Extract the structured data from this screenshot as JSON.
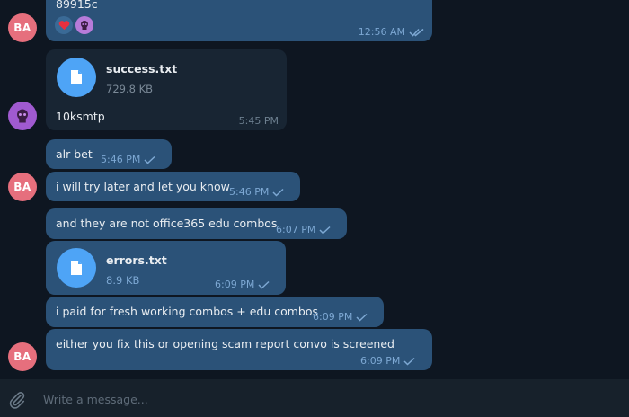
{
  "colors": {
    "background": "#0e1621",
    "outgoing_bubble": "#2b5278",
    "incoming_bubble": "#182533",
    "accent": "#4ea4f6",
    "avatar_ba": "#e66f7d",
    "avatar_other": "#a05ad0"
  },
  "messages": [
    {
      "id": "m0",
      "text": "89915c",
      "time": "12:56 AM",
      "reactions": [
        "heart",
        "skull"
      ],
      "status": "read"
    },
    {
      "id": "m1",
      "file_name": "success.txt",
      "file_size": "729.8 KB",
      "text": "10ksmtp",
      "time": "5:45 PM"
    },
    {
      "id": "m2",
      "text": "alr bet",
      "time": "5:46 PM",
      "status": "sent"
    },
    {
      "id": "m3",
      "text": "i will try later and let you know",
      "time": "5:46 PM",
      "status": "sent"
    },
    {
      "id": "m4",
      "text": "and they are not office365 edu combos",
      "time": "6:07 PM",
      "status": "sent"
    },
    {
      "id": "m5",
      "file_name": "errors.txt",
      "file_size": "8.9 KB",
      "time": "6:09 PM",
      "status": "sent"
    },
    {
      "id": "m6",
      "text": "i paid for fresh working combos + edu combos",
      "time": "6:09 PM",
      "status": "sent"
    },
    {
      "id": "m7",
      "text": "either you fix this or opening scam report convo is screened",
      "time": "6:09 PM",
      "status": "sent"
    }
  ],
  "avatars": {
    "ba": "BA"
  },
  "composer": {
    "placeholder": "Write a message..."
  }
}
